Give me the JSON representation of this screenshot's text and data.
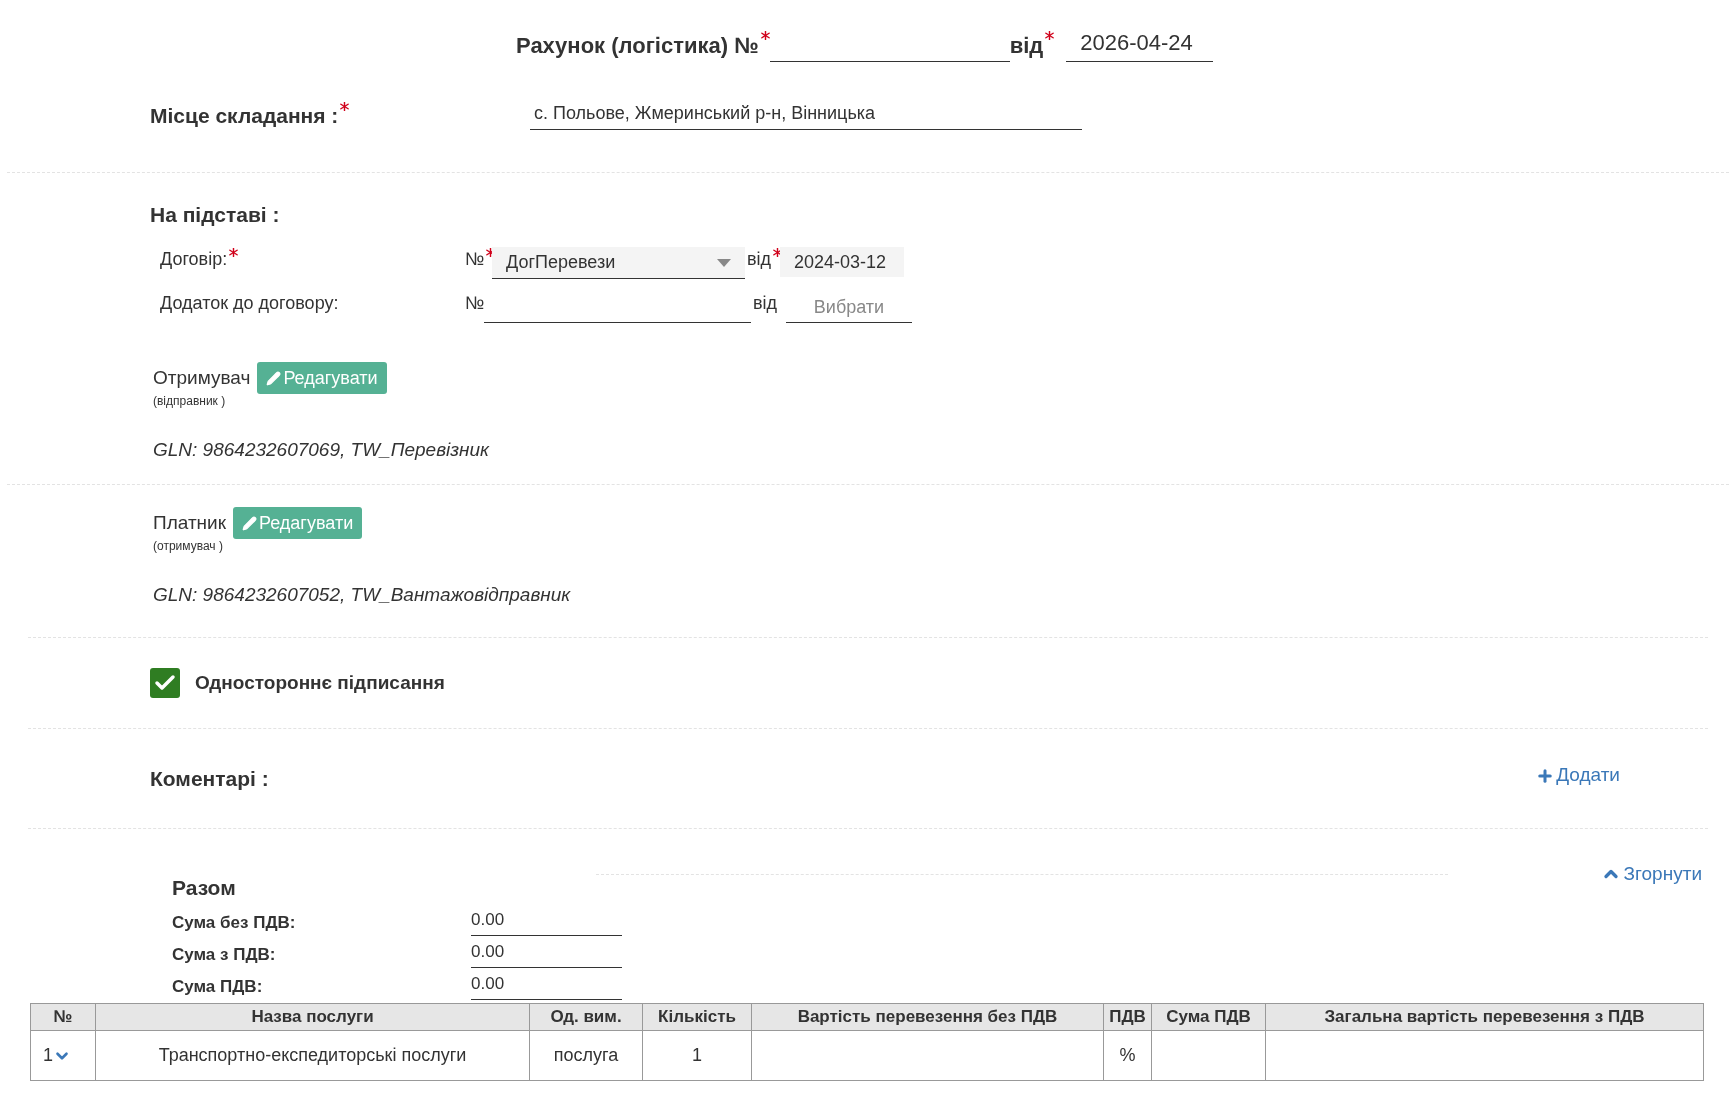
{
  "header": {
    "title": "Рахунок (логістика) №",
    "title_required": true,
    "date_label": "від",
    "date_required": true,
    "date": "2026-04-24"
  },
  "place": {
    "label": "Місце складання :",
    "required": true,
    "value": "с. Польове, Жмеринський р-н, Вінницька"
  },
  "basis": {
    "heading": "На підставі :",
    "rows": [
      {
        "label": "Договір:",
        "required": true,
        "number_label": "№",
        "number_required": true,
        "number": "ДогПеревези",
        "kind": "select",
        "date_label": "від",
        "date_required": true,
        "date": "2024-03-12"
      },
      {
        "label": "Додаток до договору:",
        "required": false,
        "number_label": "№",
        "number_required": false,
        "kind": "text",
        "date_label": "від",
        "date_required": false,
        "date_placeholder": "Вибрати"
      }
    ]
  },
  "parties": [
    {
      "label": "Отримувач",
      "role": "(відправник )",
      "button": "Редагувати",
      "info": "GLN: 9864232607069, TW_Перевізник"
    },
    {
      "label": "Платник",
      "role": "(отримувач )",
      "button": "Редагувати",
      "info": "GLN: 9864232607052, TW_Вантажовідправник"
    }
  ],
  "one_sided": {
    "label": "Одностороннє підписання",
    "checked": true
  },
  "comments": {
    "heading": "Коментарі :",
    "add": "Додати"
  },
  "totals": {
    "heading": "Разом",
    "collapse": "Згорнути",
    "expanded": true,
    "rows": [
      {
        "label": "Сума без ПДВ:",
        "value": "0.00"
      },
      {
        "label": "Сума з ПДВ:",
        "value": "0.00"
      },
      {
        "label": "Сума ПДВ:",
        "value": "0.00"
      }
    ]
  },
  "table": {
    "columns": [
      "№",
      "Назва послуги",
      "Од. вим.",
      "Кількість",
      "Вартість перевезення без ПДВ",
      "ПДВ",
      "Сума ПДВ",
      "Загальна вартість перевезення з ПДВ"
    ],
    "rows": [
      {
        "number": "1",
        "expanded": false,
        "name": "Транспортно-експедиторські послуги",
        "unit": "послуга",
        "quantity": "1",
        "vat": "%"
      }
    ]
  }
}
